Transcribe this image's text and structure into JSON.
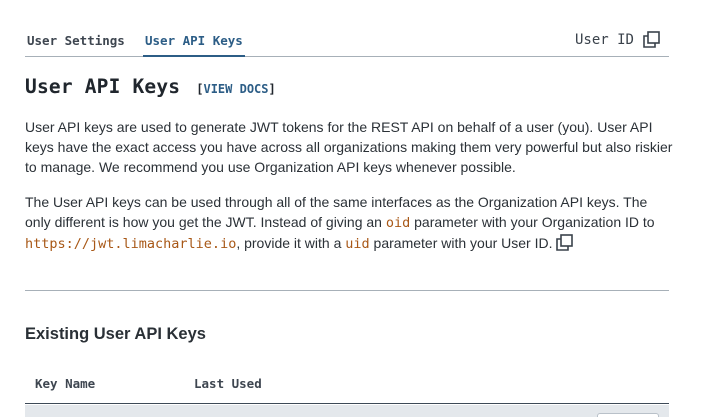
{
  "tabs": [
    {
      "label": "User Settings"
    },
    {
      "label": "User API Keys",
      "active": true
    }
  ],
  "user_id": {
    "label": "User ID",
    "icon": "copy-icon"
  },
  "heading": {
    "title": "User API Keys",
    "docs_open": "[",
    "docs_label": "VIEW DOCS",
    "docs_close": "]"
  },
  "para1": "User API keys are used to generate JWT tokens for the REST API on behalf of a user (you). User API keys have the exact access you have across all organizations making them very powerful but also riskier to manage. We recommend you use Organization API keys whenever possible.",
  "para2": {
    "t1": "The User API keys can be used through all of the same interfaces as the Organization API keys. The only different is how you get the JWT. Instead of giving an ",
    "c1": "oid",
    "t2": " parameter with your Organization ID to ",
    "c2": "https://jwt.limacharlie.io",
    "t3": ", provide it with a ",
    "c3": "uid",
    "t4": " parameter with your User ID. "
  },
  "existing": {
    "title": "Existing User API Keys",
    "columns": [
      "Key Name",
      "Last Used"
    ]
  },
  "colors": {
    "accent": "#2c5d86",
    "code": "#a85817",
    "divider": "#a7b0b8"
  }
}
